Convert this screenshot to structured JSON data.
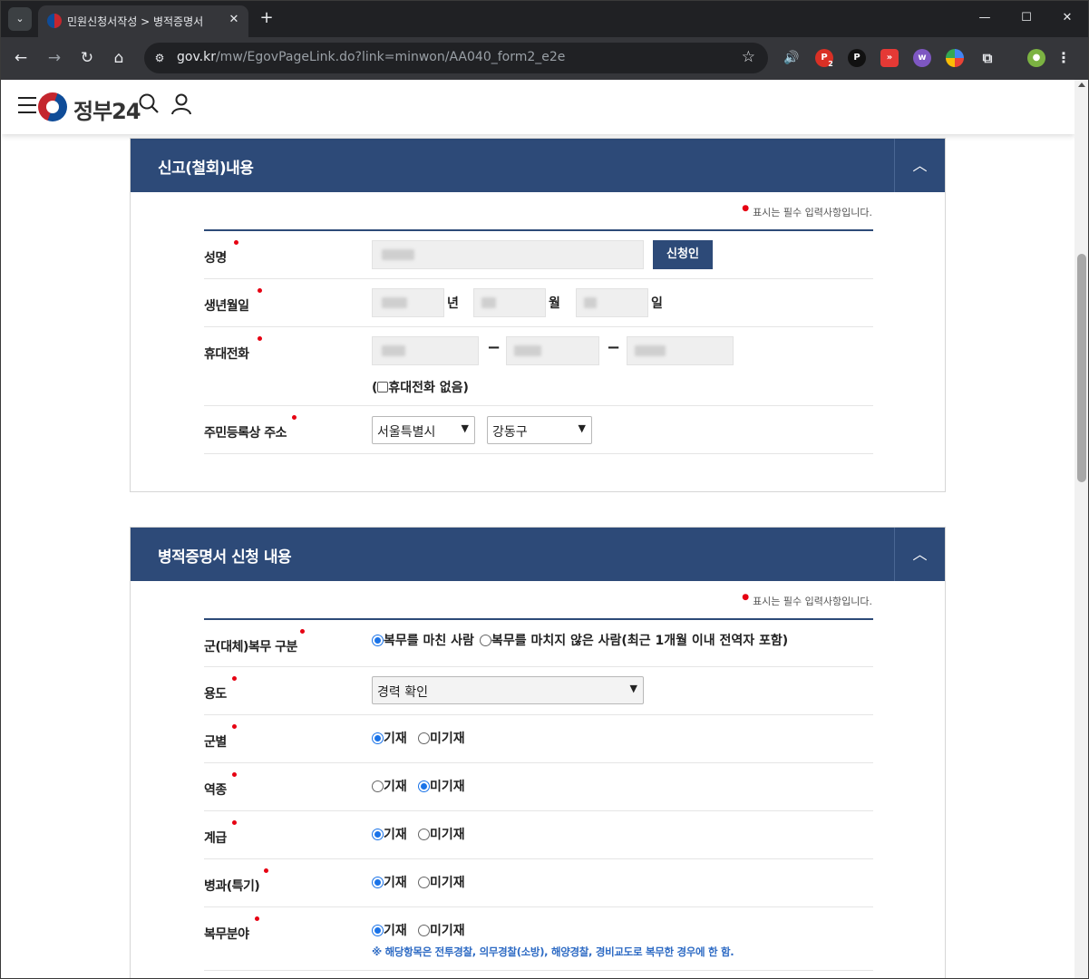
{
  "browser": {
    "tab_title": "민원신청서작성 > 병적증명서 ",
    "url_host": "gov.kr",
    "url_path": "/mw/EgovPageLink.do?link=minwon/AA040_form2_e2e",
    "ext_badge": "2"
  },
  "header": {
    "logo_text": "정부24"
  },
  "section1": {
    "title": "신고(철회)내용",
    "toggle": "︿",
    "required_note": "표시는 필수 입력사항입니다.",
    "name_label": "성명",
    "applicant_button": "신청인",
    "birth_label": "생년월일",
    "year_unit": "년",
    "month_unit": "월",
    "day_unit": "일",
    "phone_label": "휴대전화",
    "phone_sep": "−",
    "no_phone_prefix": "(",
    "no_phone_label": "휴대전화 없음)",
    "address_label": "주민등록상 주소",
    "city_value": "서울특별시",
    "district_value": "강동구"
  },
  "section2": {
    "title": "병적증명서 신청 내용",
    "toggle": "︿",
    "required_note": "표시는 필수 입력사항입니다.",
    "service_type_label": "군(대체)복무 구분",
    "service_done": "복무를 마친 사람",
    "service_not_done": "복무를 마치지 않은 사람(최근 1개월 이내 전역자 포함)",
    "purpose_label": "용도",
    "purpose_value": "경력 확인",
    "include": "기재",
    "exclude": "미기재",
    "branch_label": "군별",
    "category_label": "역종",
    "rank_label": "계급",
    "specialty_label": "병과(특기)",
    "field_label": "복무분야",
    "field_note": "※ 해당항목은 전투경찰, 의무경찰(소방), 해양경찰, 경비교도로 복무한 경우에 한 함."
  },
  "selections": {
    "service_type": "done",
    "branch": "include",
    "category": "exclude",
    "rank": "include",
    "specialty": "include",
    "field": "include"
  }
}
